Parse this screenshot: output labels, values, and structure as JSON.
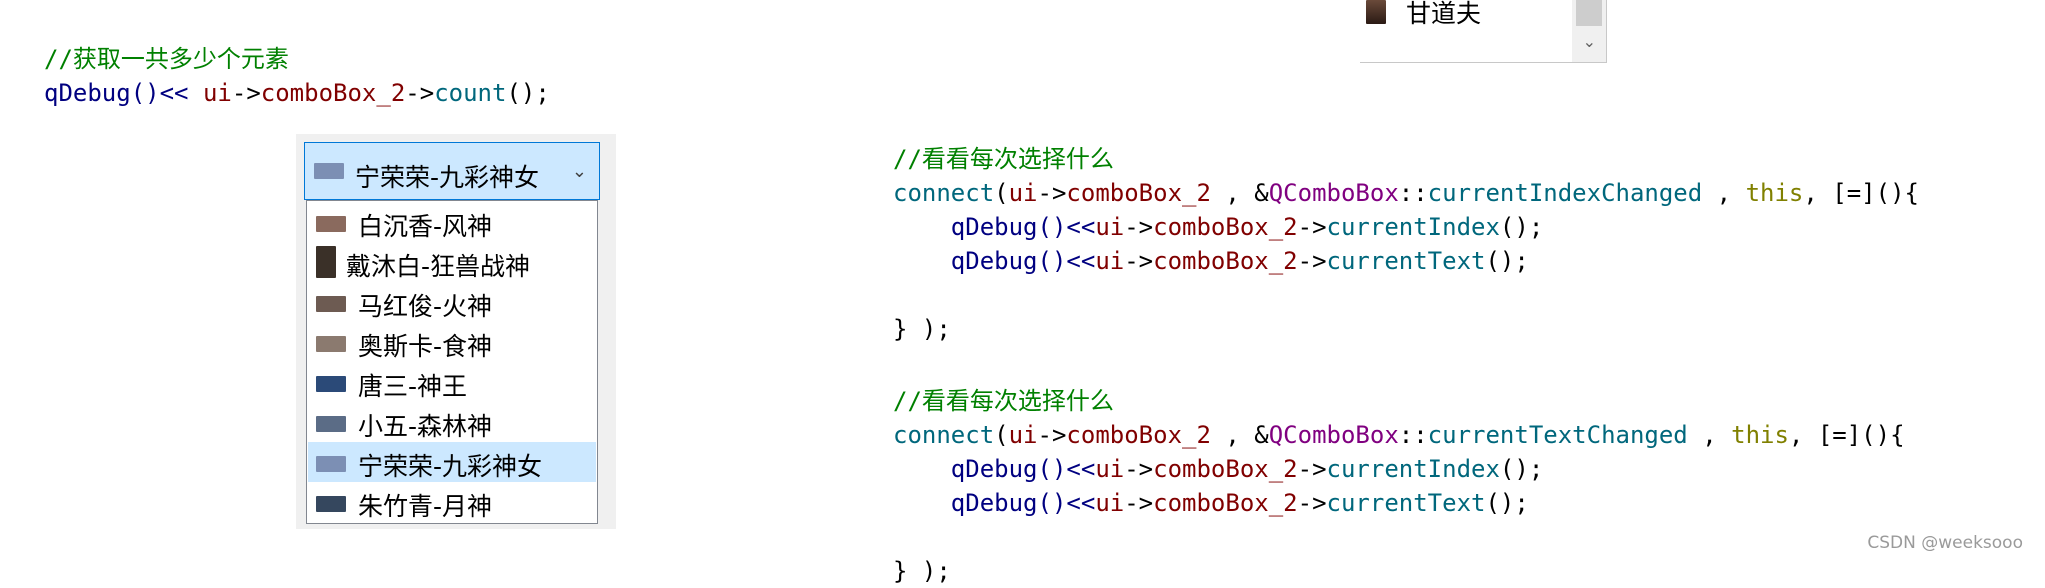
{
  "left_code": {
    "comment": "//获取一共多少个元素",
    "line": {
      "fn": "qDebug",
      "p1": "()",
      "op1": "<< ",
      "ui": "ui",
      "arrow1": "->",
      "member": "comboBox_2",
      "arrow2": "->",
      "method": "count",
      "tail": "();"
    }
  },
  "top_fragment": {
    "item": "甘道夫",
    "scroll_arrow": "⌄"
  },
  "combo": {
    "current": "宁荣荣-九彩神女",
    "dropdown_arrow": "⌄",
    "items": [
      {
        "label": "白沉香-风神",
        "thumb_color": "#8a6a5e"
      },
      {
        "label": "戴沐白-狂兽战神",
        "thumb_color": "#3a3028"
      },
      {
        "label": "马红俊-火神",
        "thumb_color": "#6d5b52"
      },
      {
        "label": "奥斯卡-食神",
        "thumb_color": "#8b7a6f"
      },
      {
        "label": "唐三-神王",
        "thumb_color": "#2b4a78"
      },
      {
        "label": "小五-森林神",
        "thumb_color": "#5b6c86"
      },
      {
        "label": "宁荣荣-九彩神女",
        "thumb_color": "#7c8fb4"
      },
      {
        "label": "朱竹青-月神",
        "thumb_color": "#35475e"
      }
    ],
    "selected_index": 6
  },
  "right_code": [
    {
      "comment": "//看看每次选择什么",
      "connect": "connect",
      "p_open": "(",
      "ui": "ui",
      "arrow": "->",
      "member": "comboBox_2",
      "sep": " , &",
      "cls": "QComboBox",
      "scope": "::",
      "signal": "currentIndexChanged",
      "sep2": " , ",
      "this": "this",
      "lambda": ", [=](){",
      "l1": {
        "fn": "qDebug",
        "p": "()",
        "op": "<<",
        "ui": "ui",
        "a1": "->",
        "member": "comboBox_2",
        "a2": "->",
        "method": "currentIndex",
        "tail": "();"
      },
      "l2": {
        "fn": "qDebug",
        "p": "()",
        "op": "<<",
        "ui": "ui",
        "a1": "->",
        "member": "comboBox_2",
        "a2": "->",
        "method": "currentText",
        "tail": "();"
      },
      "close": "} );"
    },
    {
      "comment": "//看看每次选择什么",
      "connect": "connect",
      "p_open": "(",
      "ui": "ui",
      "arrow": "->",
      "member": "comboBox_2",
      "sep": " , &",
      "cls": "QComboBox",
      "scope": "::",
      "signal": "currentTextChanged",
      "sep2": " , ",
      "this": "this",
      "lambda": ", [=](){",
      "l1": {
        "fn": "qDebug",
        "p": "()",
        "op": "<<",
        "ui": "ui",
        "a1": "->",
        "member": "comboBox_2",
        "a2": "->",
        "method": "currentIndex",
        "tail": "();"
      },
      "l2": {
        "fn": "qDebug",
        "p": "()",
        "op": "<<",
        "ui": "ui",
        "a1": "->",
        "member": "comboBox_2",
        "a2": "->",
        "method": "currentText",
        "tail": "();"
      },
      "close": "} );"
    }
  ],
  "watermark": "CSDN @weeksooo",
  "colors": {
    "comment": "#008000",
    "keyword": "#808000",
    "function": "#00677c",
    "member": "#800000",
    "class": "#800080",
    "selection": "#cce8ff",
    "focus_border": "#0078d7"
  }
}
